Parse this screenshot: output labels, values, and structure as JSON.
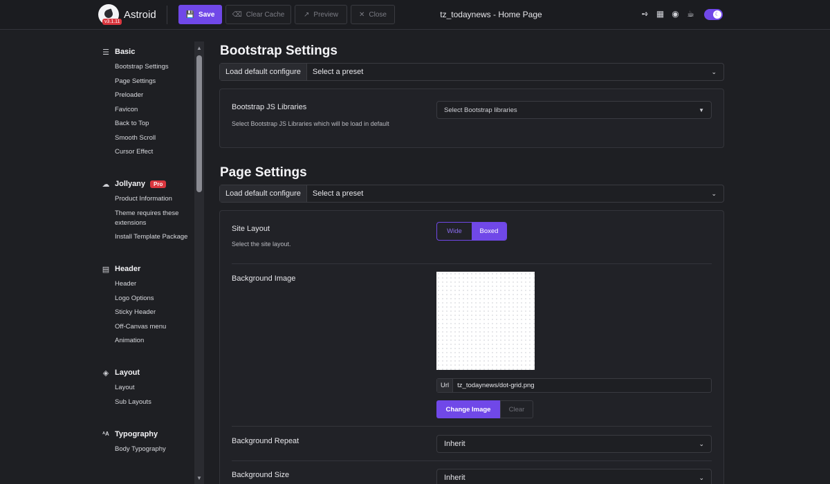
{
  "app": {
    "name": "Astroid",
    "version": "v3.1.11"
  },
  "toolbar": {
    "save": "Save",
    "clear_cache": "Clear Cache",
    "preview": "Preview",
    "close": "Close"
  },
  "page_title": "tz_todaynews - Home Page",
  "sidebar": {
    "groups": [
      {
        "title": "Basic",
        "icon": "sliders-icon",
        "items": [
          "Bootstrap Settings",
          "Page Settings",
          "Preloader",
          "Favicon",
          "Back to Top",
          "Smooth Scroll",
          "Cursor Effect"
        ]
      },
      {
        "title": "Jollyany",
        "badge": "Pro",
        "icon": "cloud-icon",
        "items": [
          "Product Information",
          "Theme requires these extensions",
          "Install Template Package"
        ]
      },
      {
        "title": "Header",
        "icon": "header-icon",
        "items": [
          "Header",
          "Logo Options",
          "Sticky Header",
          "Off-Canvas menu",
          "Animation"
        ]
      },
      {
        "title": "Layout",
        "icon": "layers-icon",
        "items": [
          "Layout",
          "Sub Layouts"
        ]
      },
      {
        "title": "Typography",
        "icon": "font-size-icon",
        "items": [
          "Body Typography"
        ]
      }
    ]
  },
  "bootstrap": {
    "title": "Bootstrap Settings",
    "preset_label": "Load default configure",
    "preset_placeholder": "Select a preset",
    "js_label": "Bootstrap JS Libraries",
    "js_help": "Select Bootstrap JS Libraries which will be load in default",
    "js_placeholder": "Select Bootstrap libraries"
  },
  "page_settings": {
    "title": "Page Settings",
    "preset_label": "Load default configure",
    "preset_placeholder": "Select a preset",
    "layout_label": "Site Layout",
    "layout_help": "Select the site layout.",
    "layout_options": [
      "Wide",
      "Boxed"
    ],
    "layout_selected": "Boxed",
    "bg_image_label": "Background Image",
    "url_label": "Url",
    "url_value": "tz_todaynews/dot-grid.png",
    "change_image": "Change Image",
    "clear": "Clear",
    "bg_repeat_label": "Background Repeat",
    "bg_repeat_value": "Inherit",
    "bg_size_label": "Background Size",
    "bg_size_value": "Inherit"
  },
  "colors": {
    "accent": "#7048e8",
    "background": "#1e1f23",
    "badge": "#d9363e"
  }
}
